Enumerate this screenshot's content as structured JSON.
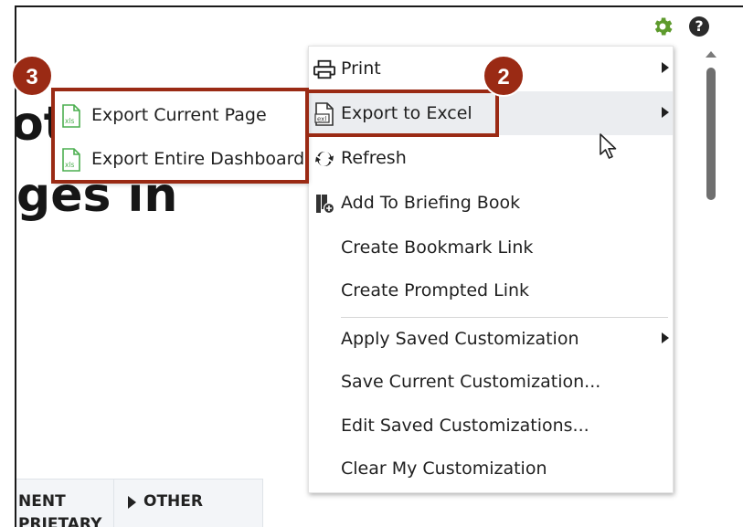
{
  "background": {
    "heading_line1": "ot",
    "heading_line2": "ges in",
    "table_col1_line1": "NENT",
    "table_col1_line2": "PRIETARY",
    "table_col2": "OTHER"
  },
  "toolbar": {
    "settings_icon": "gear-icon",
    "help_icon": "help-icon",
    "help_glyph": "?"
  },
  "menu": {
    "items": [
      {
        "label": "Print",
        "icon": "printer-icon",
        "has_submenu": true
      },
      {
        "label": "Export to Excel",
        "icon": "excel-export-icon",
        "has_submenu": true,
        "highlighted": true
      },
      {
        "label": "Refresh",
        "icon": "refresh-icon",
        "has_submenu": false
      },
      {
        "label": "Add To Briefing Book",
        "icon": "briefing-book-icon",
        "has_submenu": false
      },
      {
        "label": "Create Bookmark Link",
        "icon": "",
        "has_submenu": false
      },
      {
        "label": "Create Prompted Link",
        "icon": "",
        "has_submenu": false
      },
      {
        "label": "Apply Saved Customization",
        "icon": "",
        "has_submenu": true
      },
      {
        "label": "Save Current Customization...",
        "icon": "",
        "has_submenu": false
      },
      {
        "label": "Edit Saved Customizations...",
        "icon": "",
        "has_submenu": false
      },
      {
        "label": "Clear My Customization",
        "icon": "",
        "has_submenu": false
      }
    ]
  },
  "submenu": {
    "items": [
      {
        "label": "Export Current Page",
        "icon": "xls-file-icon",
        "icon_text": "xls"
      },
      {
        "label": "Export Entire Dashboard",
        "icon": "xls-file-icon",
        "icon_text": "xls"
      }
    ]
  },
  "callouts": {
    "step_export_to_excel": "2",
    "step_export_options": "3"
  },
  "colors": {
    "callout": "#9a2a14",
    "gear": "#5d9a2c",
    "menu_highlight": "#ebedf0",
    "xls_icon": "#4caf50"
  }
}
